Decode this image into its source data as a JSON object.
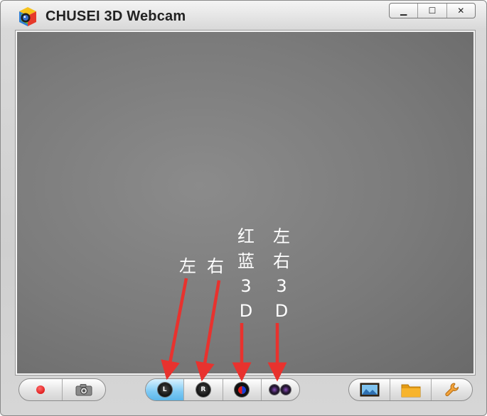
{
  "window": {
    "title": "CHUSEI 3D Webcam",
    "controls": {
      "minimize": "▁",
      "maximize": "☐",
      "close": "✕"
    }
  },
  "annotations": {
    "left_label": "左",
    "right_label": "右",
    "red_blue_label": "红蓝3D",
    "side_by_side_label": "左右3D",
    "arrow_color": "#e8322e"
  },
  "toolbar": {
    "record_icon": "record-dot-icon",
    "snapshot_icon": "camera-icon",
    "view_modes": [
      {
        "name": "left-eye",
        "badge": "L",
        "active": true
      },
      {
        "name": "right-eye",
        "badge": "R",
        "active": false
      },
      {
        "name": "anaglyph",
        "badge": "",
        "active": false
      },
      {
        "name": "side-by-side",
        "badge": "",
        "active": false
      }
    ],
    "gallery_icon": "picture-icon",
    "folder_icon": "folder-icon",
    "settings_icon": "wrench-icon"
  },
  "colors": {
    "active_mode": "#7cc9f4",
    "record": "#d40000",
    "folder": "#f2a51e"
  }
}
